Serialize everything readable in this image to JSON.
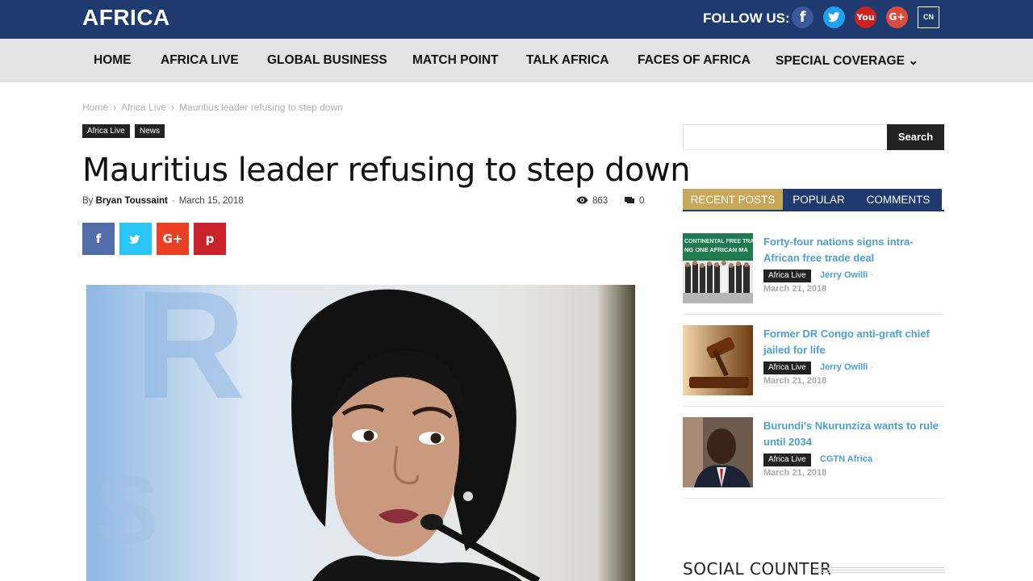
{
  "header": {
    "logo": "AFRICA",
    "follow_label": "FOLLOW US:",
    "social": [
      {
        "icon": "facebook-icon",
        "glyph": "f"
      },
      {
        "icon": "twitter-icon",
        "glyph": "t"
      },
      {
        "icon": "youtube-icon",
        "glyph": "You"
      },
      {
        "icon": "google-plus-icon",
        "glyph": "G+"
      },
      {
        "icon": "square-logo-icon",
        "glyph": "CN"
      }
    ]
  },
  "nav": [
    "HOME",
    "AFRICA LIVE",
    "GLOBAL BUSINESS",
    "MATCH POINT",
    "TALK AFRICA",
    "FACES OF AFRICA",
    "SPECIAL COVERAGE ⌄"
  ],
  "breadcrumb": [
    "Home",
    "Africa Live",
    "Mauritius leader refusing to step down"
  ],
  "breadcrumb_sep": "›",
  "article": {
    "tags": [
      "Africa Live",
      "News"
    ],
    "title": "Mauritius leader refusing to step down",
    "by": "By",
    "author": "Bryan Toussaint",
    "dash": "-",
    "date": "March 15, 2018",
    "views": "863",
    "comments": "0",
    "share": [
      "f",
      "t",
      "G+",
      "p"
    ]
  },
  "sidebar": {
    "search_button": "Search",
    "tabs": [
      "RECENT POSTS",
      "POPULAR",
      "COMMENTS"
    ],
    "posts": [
      {
        "title": "Forty-four nations signs intra-African free trade deal",
        "category": "Africa Live",
        "author": "Jerry Owilli",
        "dash": "-",
        "date": "March 21, 2018"
      },
      {
        "title": "Former DR Congo anti-graft chief jailed for life",
        "category": "Africa Live",
        "author": "Jerry Owilli",
        "dash": "-",
        "date": "March 21, 2018"
      },
      {
        "title": "Burundi's Nkurunziza wants to rule until 2034",
        "category": "Africa Live",
        "author": "CGTN Africa",
        "dash": "-",
        "date": "March 21, 2018"
      }
    ],
    "social_counter": "SOCIAL COUNTER"
  },
  "colors": {
    "navy": "#1e3a6e",
    "gold": "#c6a85b",
    "link_blue": "#4a9fd8",
    "nav_gray": "#e3e3e3"
  }
}
